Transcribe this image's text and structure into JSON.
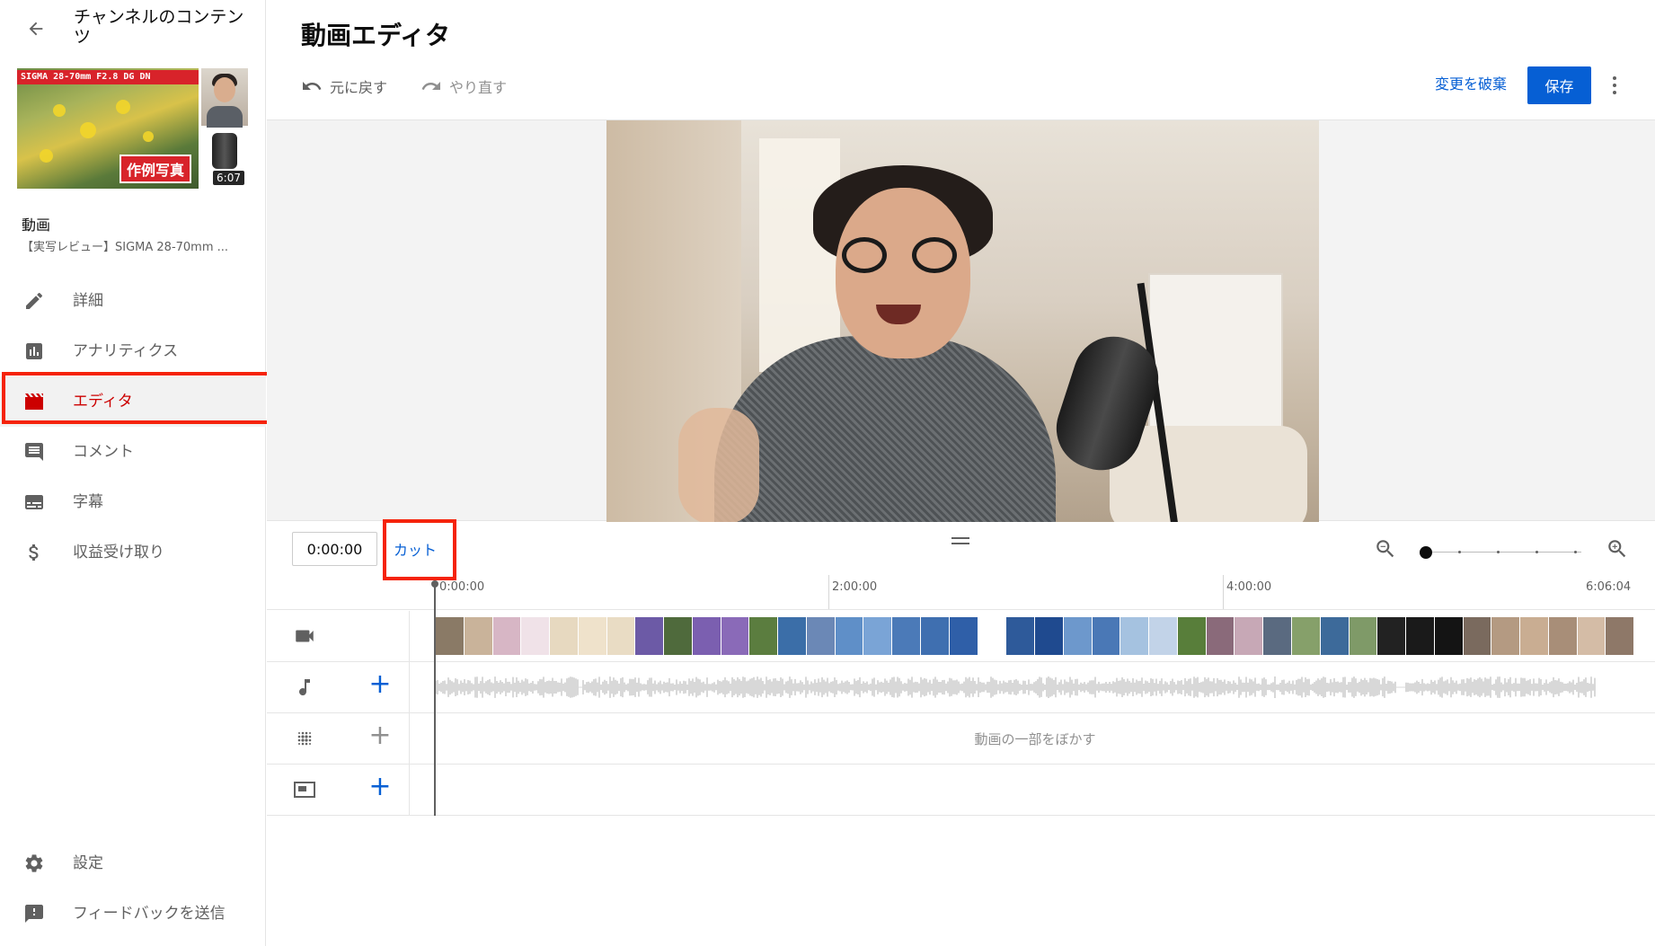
{
  "sidebar": {
    "title": "チャンネルのコンテンツ",
    "thumbnail": {
      "banner_text": "SIGMA 28-70mm F2.8 DG DN",
      "overlay_text": "作例写真",
      "duration": "6:07"
    },
    "video_section_label": "動画",
    "video_title": "【実写レビュー】SIGMA 28-70mm ...",
    "items": [
      {
        "label": "詳細",
        "icon": "pencil-icon"
      },
      {
        "label": "アナリティクス",
        "icon": "analytics-icon"
      },
      {
        "label": "エディタ",
        "icon": "clapperboard-icon",
        "active": true
      },
      {
        "label": "コメント",
        "icon": "comment-icon"
      },
      {
        "label": "字幕",
        "icon": "subtitles-icon"
      },
      {
        "label": "収益受け取り",
        "icon": "dollar-icon"
      }
    ],
    "bottom_items": [
      {
        "label": "設定",
        "icon": "gear-icon"
      },
      {
        "label": "フィードバックを送信",
        "icon": "feedback-icon"
      }
    ]
  },
  "header": {
    "title": "動画エディタ",
    "undo_label": "元に戻す",
    "redo_label": "やり直す",
    "discard_label": "変更を破棄",
    "save_label": "保存"
  },
  "timeline": {
    "current_time": "0:00:00",
    "cut_label": "カット",
    "ruler": [
      "0:00:00",
      "2:00:00",
      "4:00:00",
      "6:06:04"
    ],
    "blur_label": "動画の一部をぼかす",
    "zoom_level": 0
  },
  "colors": {
    "accent": "#065fd4",
    "active": "#cc0000",
    "highlight": "#f5230a"
  },
  "filmstrip_colors": [
    "#8a7a66",
    "#c9b39a",
    "#d7b6c5",
    "#f0e2e8",
    "#e7d9c0",
    "#efe2cb",
    "#e9dcc4",
    "#6c5aa6",
    "#4f6a3c",
    "#7b5fb0",
    "#8a6ab8",
    "#5b7d3f",
    "#3b6ea8",
    "#6b88b6",
    "#5f8fc8",
    "#7aa4d6",
    "#4b7ab8",
    "#3f6fb0",
    "#2f5fa8",
    "#ffffff",
    "#2e5a9a",
    "#1f4a8f",
    "#6d98cc",
    "#4a78b6",
    "#a5c2e0",
    "#c2d3e8",
    "#587e3a",
    "#8a6a7a",
    "#c7a8b6",
    "#5a6a80",
    "#86a06a",
    "#3d6a9a",
    "#7f9a68",
    "#222222",
    "#1a1a1a",
    "#141414",
    "#7a6a5e",
    "#b49a82",
    "#c9ad92",
    "#a88e78",
    "#d4bca6",
    "#8e7868"
  ]
}
